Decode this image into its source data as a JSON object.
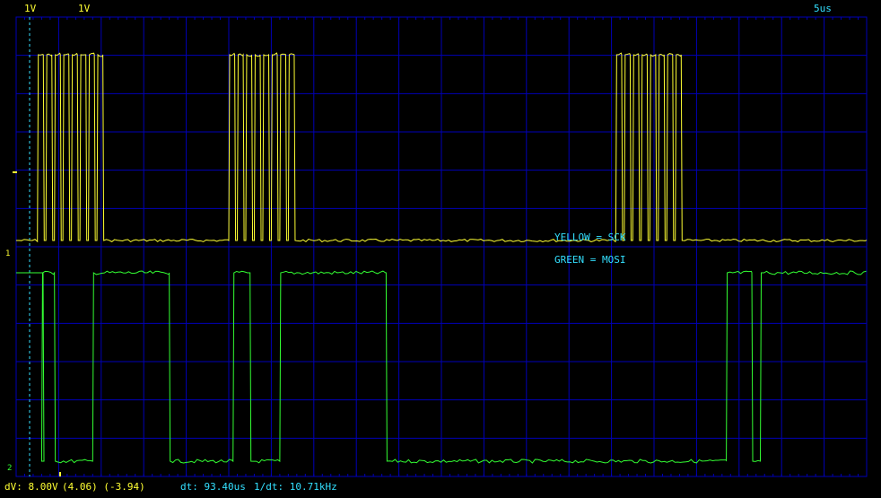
{
  "header": {
    "ch1_scale": "1V",
    "ch2_scale": "1V",
    "timebase": "5us"
  },
  "markers": {
    "ch1": "1",
    "ch2": "2"
  },
  "legend": {
    "yellow": "YELLOW = SCK",
    "green": "GREEN  =  MOSI"
  },
  "status": {
    "dv": "dV: 8.00V",
    "dv_detail": "(4.06) (-3.94)",
    "dt": "dt: 93.40us",
    "freq": "1/dt: 10.71kHz"
  },
  "colors": {
    "ch1": "#ffff33",
    "ch2": "#33ff33",
    "grid": "#0000b8",
    "text_cyan": "#33e0ff",
    "text_yellow": "#ffff33"
  },
  "sck_bursts_us": [
    {
      "start": 2.5,
      "pulses": 8
    },
    {
      "start": 25.0,
      "pulses": 8
    },
    {
      "start": 70.5,
      "pulses": 8
    }
  ],
  "mosi_level_changes_us": [
    {
      "t": 3.0,
      "level": "high"
    },
    {
      "t": 4.5,
      "level": "low"
    },
    {
      "t": 9.0,
      "level": "high"
    },
    {
      "t": 18.0,
      "level": "low"
    },
    {
      "t": 25.5,
      "level": "high"
    },
    {
      "t": 27.5,
      "level": "low"
    },
    {
      "t": 31.0,
      "level": "high"
    },
    {
      "t": 43.5,
      "level": "low"
    },
    {
      "t": 83.5,
      "level": "high"
    },
    {
      "t": 86.5,
      "level": "low"
    },
    {
      "t": 87.5,
      "level": "high"
    }
  ]
}
